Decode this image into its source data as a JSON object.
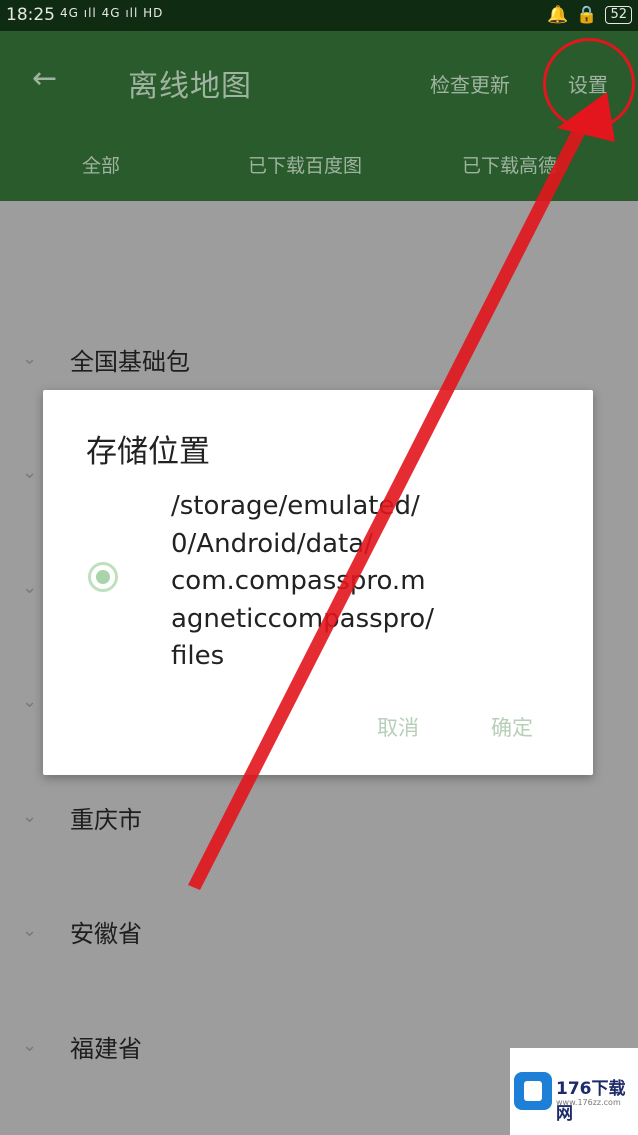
{
  "status_bar": {
    "time": "18:25",
    "signal": "4G ıll 4G ıll",
    "hd": "HD",
    "battery": "52"
  },
  "app_bar": {
    "title": "离线地图",
    "check_update": "检查更新",
    "settings": "设置",
    "tabs": [
      "全部",
      "已下载百度图",
      "已下载高德"
    ]
  },
  "list": {
    "items": [
      "全国基础包",
      "重庆市",
      "安徽省",
      "福建省"
    ]
  },
  "dialog": {
    "title": "存储位置",
    "path_lines": [
      "/storage/emulated/",
      "0/Android/data/",
      "com.compasspro.m",
      "agneticcompasspro/",
      "files"
    ],
    "cancel": "取消",
    "ok": "确定"
  },
  "watermark": {
    "name": "176下载网",
    "url": "www.176zz.com"
  },
  "colors": {
    "appbar": "#2a5b2c",
    "annotation": "#e3151d"
  }
}
